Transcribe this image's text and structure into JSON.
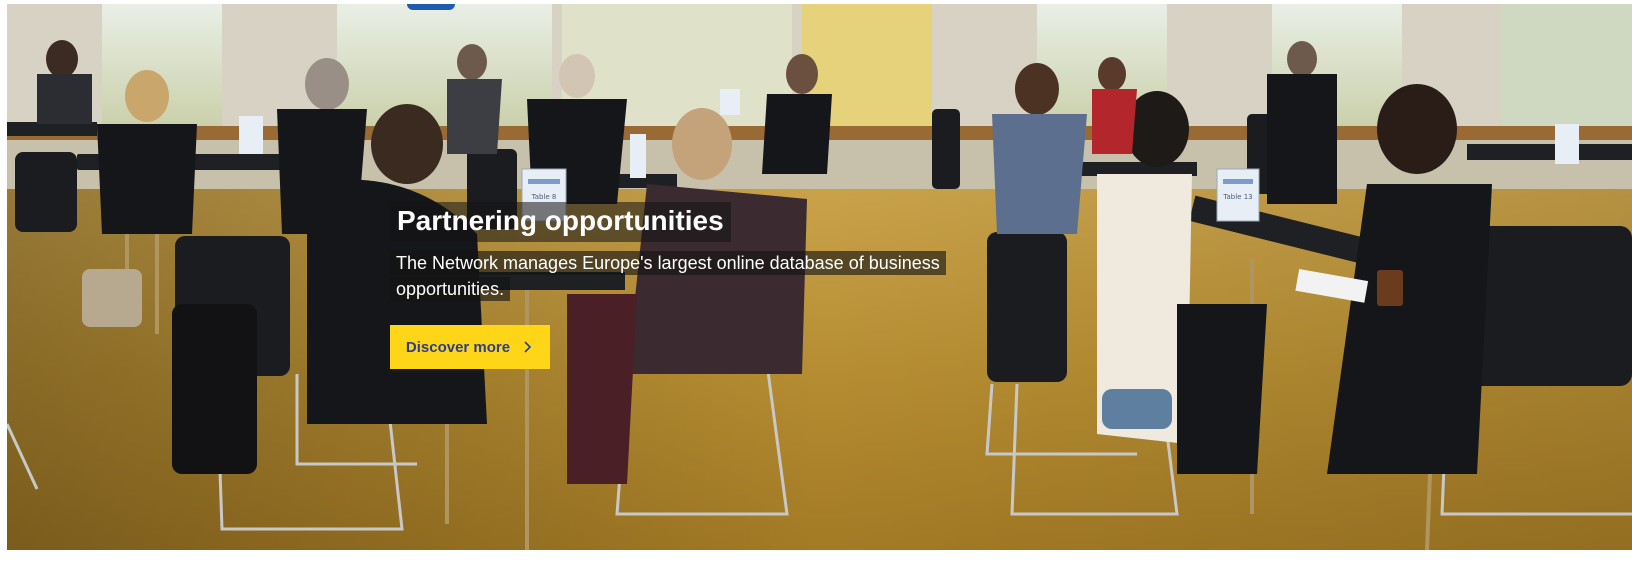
{
  "hero": {
    "title": "Partnering opportunities",
    "description": "The Network manages Europe's largest online database of business opportunities.",
    "cta_label": "Discover more",
    "cta_icon": "chevron-right-icon",
    "image_subject": "",
    "table_cards": [
      "Table 8",
      "Table 13"
    ]
  },
  "colors": {
    "cta_background": "#ffd617",
    "cta_text": "#2c3e8f",
    "logo_blue": "#1c5db1",
    "carpet": "#b89236"
  }
}
